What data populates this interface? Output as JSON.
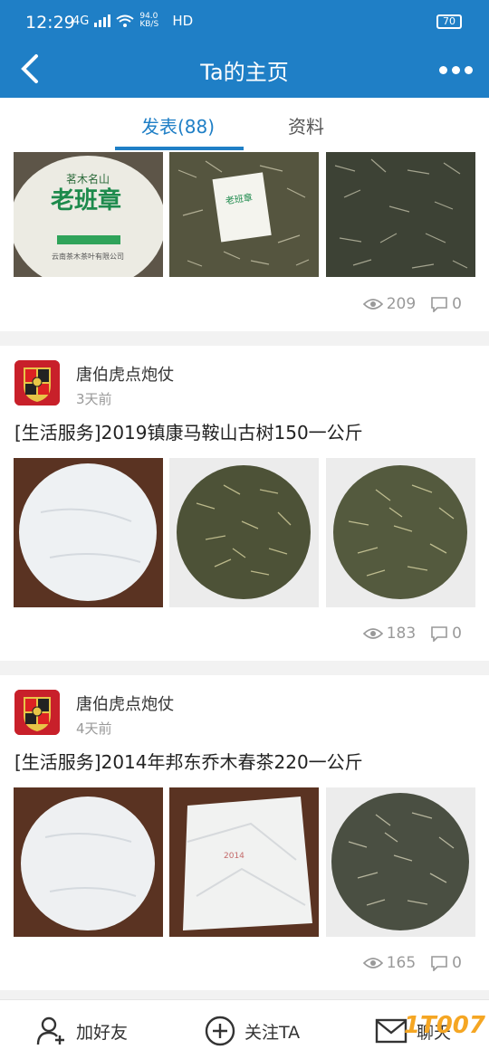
{
  "status": {
    "time": "12:29",
    "network": "4G",
    "speed": "94.0 KB/S",
    "hd": "HD",
    "battery": "70"
  },
  "header": {
    "title": "Ta的主页"
  },
  "tabs": [
    {
      "label": "发表(88)"
    },
    {
      "label": "资料"
    }
  ],
  "posts": [
    {
      "views": "209",
      "comments": "0"
    },
    {
      "author": "唐伯虎点炮仗",
      "time": "3天前",
      "title": "[生活服务]2019镇康马鞍山古树150一公斤",
      "views": "183",
      "comments": "0"
    },
    {
      "author": "唐伯虎点炮仗",
      "time": "4天前",
      "title": "[生活服务]2014年邦东乔木春茶220一公斤",
      "views": "165",
      "comments": "0"
    }
  ],
  "bottom": {
    "add_friend": "加好友",
    "follow": "关注TA",
    "chat": "聊天"
  },
  "watermark": "1T007",
  "colors": {
    "primary": "#1f7fc6",
    "muted": "#999999"
  }
}
